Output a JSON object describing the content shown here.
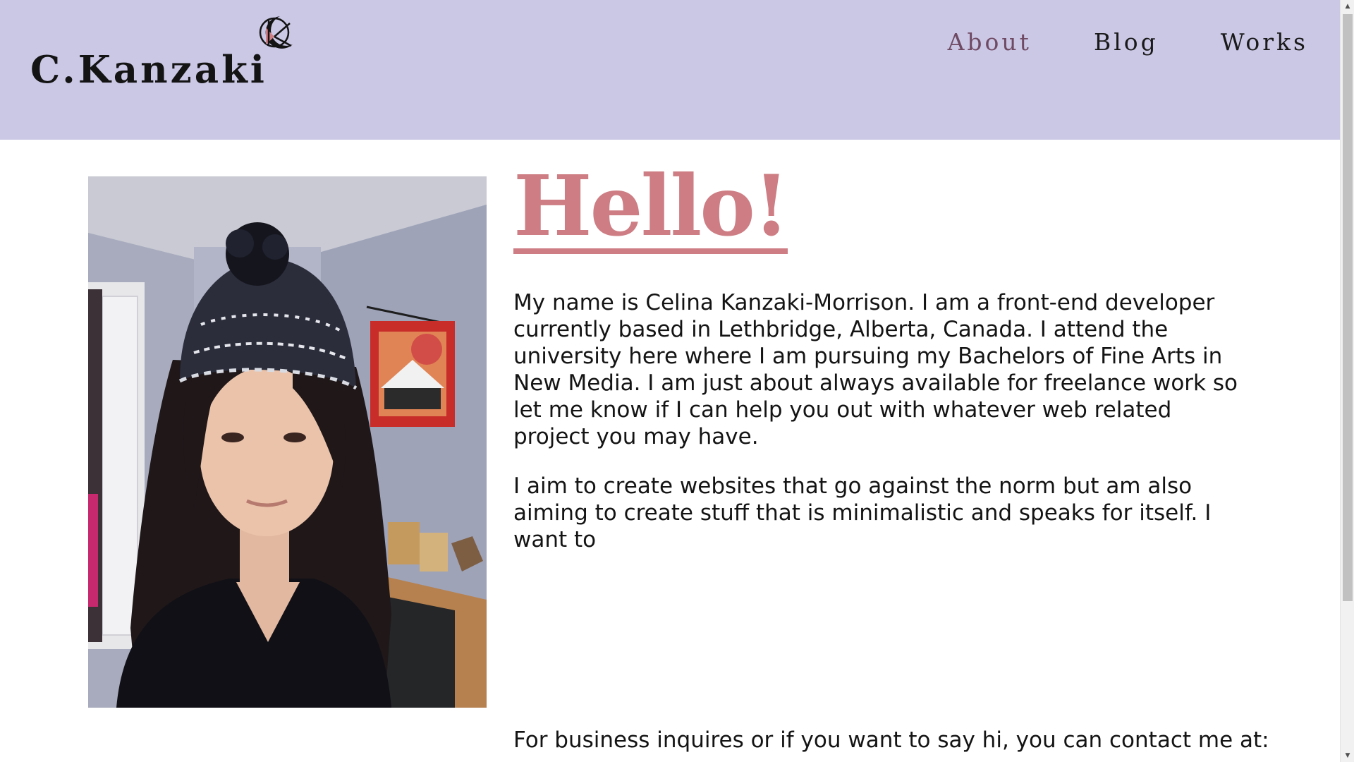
{
  "header": {
    "brand": "C.Kanzaki",
    "logo_icon": "crescent-moon-logo",
    "nav": [
      {
        "label": "About",
        "active": true
      },
      {
        "label": "Blog",
        "active": false
      },
      {
        "label": "Works",
        "active": false
      }
    ]
  },
  "main": {
    "heading": "Hello!",
    "paragraph1": "My name is Celina Kanzaki-Morrison. I am a front-end developer currently based in Lethbridge, Alberta, Canada. I attend the university here where I am pursuing my Bachelors of Fine Arts in New Media. I am just about always available for freelance work so let me know if I can help you out with whatever web related project you may have.",
    "paragraph2": "I aim to create websites that go against the norm but am also aiming to create stuff that is minimalistic and speaks for itself. I want to",
    "contact_text": "For business inquires or if you want to say hi, you can contact me at:"
  },
  "colors": {
    "header_bg": "#cbc8e6",
    "accent": "#cd7d83",
    "active_nav": "#6f4a63"
  }
}
